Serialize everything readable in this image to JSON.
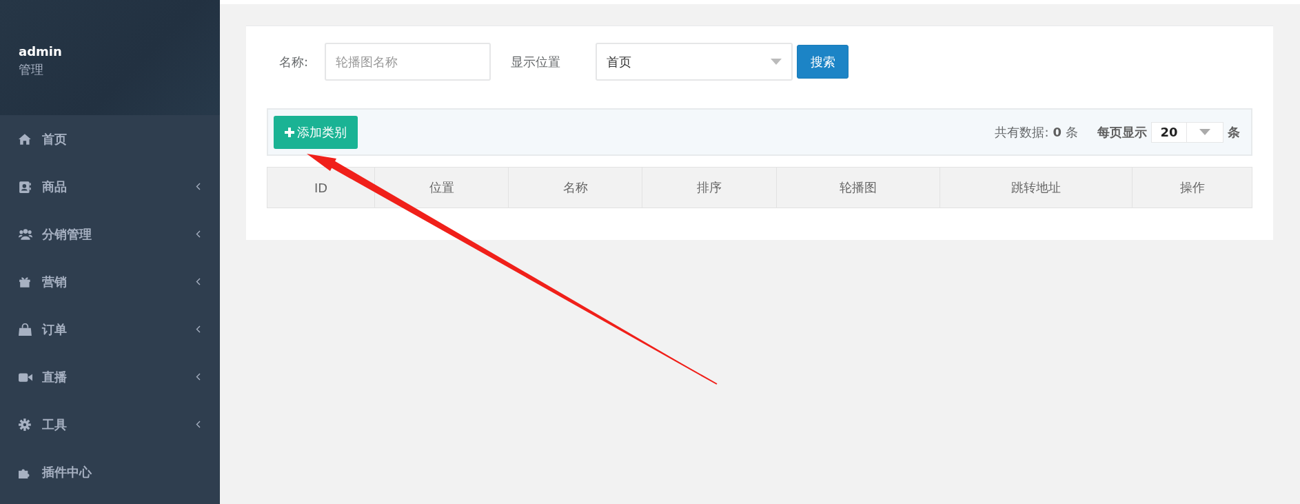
{
  "sidebar": {
    "user": {
      "name": "admin",
      "role": "管理"
    },
    "items": [
      {
        "label": "首页",
        "has_children": false
      },
      {
        "label": "商品",
        "has_children": true
      },
      {
        "label": "分销管理",
        "has_children": true
      },
      {
        "label": "营销",
        "has_children": true
      },
      {
        "label": "订单",
        "has_children": true
      },
      {
        "label": "直播",
        "has_children": true
      },
      {
        "label": "工具",
        "has_children": true
      },
      {
        "label": "插件中心",
        "has_children": false
      }
    ]
  },
  "filter": {
    "name_label": "名称:",
    "name_placeholder": "轮播图名称",
    "position_label": "显示位置",
    "position_value": "首页",
    "search_button": "搜索"
  },
  "toolbar": {
    "add_button": "添加类别",
    "total_label": "共有数据:",
    "total_count": "0",
    "total_unit": "条",
    "per_page_label": "每页显示",
    "per_page_value": "20",
    "per_page_unit": "条"
  },
  "table": {
    "columns": [
      "ID",
      "位置",
      "名称",
      "排序",
      "轮播图",
      "跳转地址",
      "操作"
    ]
  }
}
